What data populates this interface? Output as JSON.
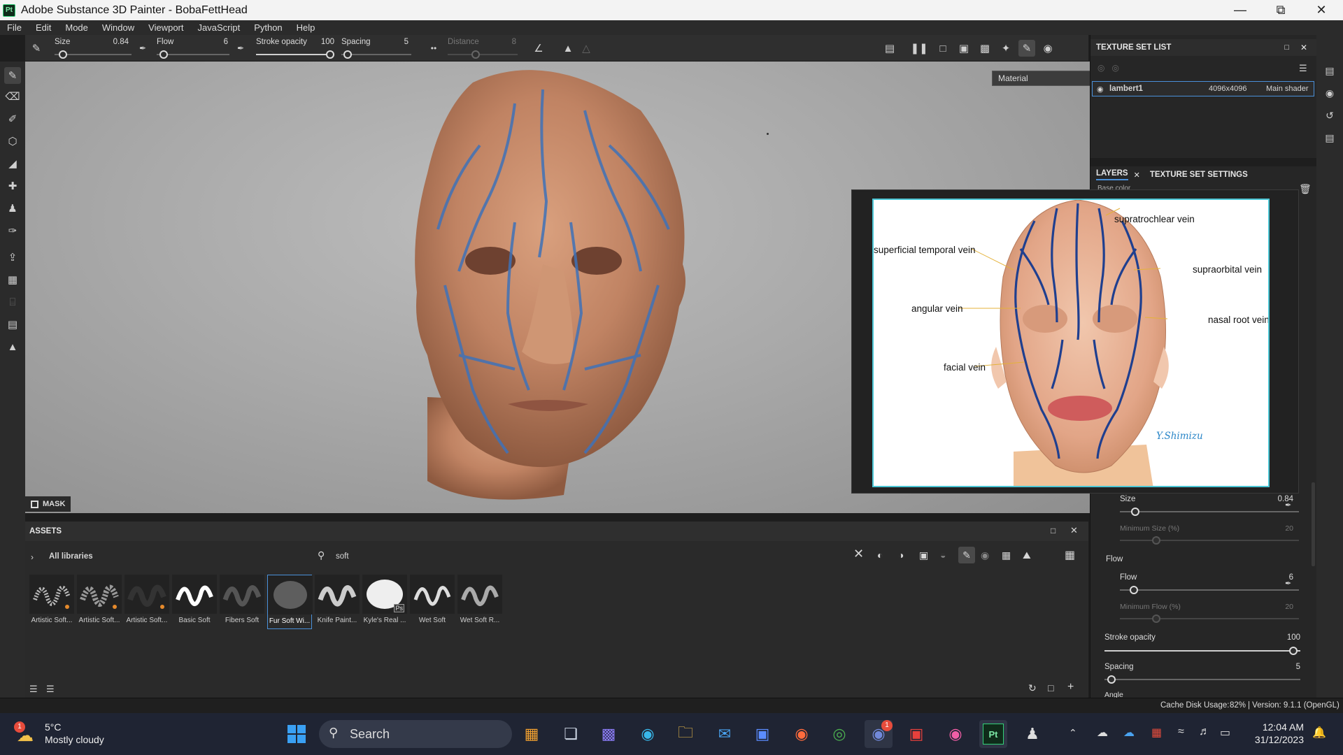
{
  "window": {
    "title": "Adobe Substance 3D Painter - BobaFettHead",
    "app_icon": "Pt"
  },
  "menu": [
    "File",
    "Edit",
    "Mode",
    "Window",
    "Viewport",
    "JavaScript",
    "Python",
    "Help"
  ],
  "tool_options": {
    "size_label": "Size",
    "size_value": "0.84",
    "flow_label": "Flow",
    "flow_value": "6",
    "stroke_opacity_label": "Stroke opacity",
    "stroke_opacity_value": "100",
    "spacing_label": "Spacing",
    "spacing_value": "5",
    "distance_label": "Distance",
    "distance_value": "8"
  },
  "viewport": {
    "material_mode": "Material",
    "mask_label": "MASK"
  },
  "texture_set_list": {
    "title": "TEXTURE SET LIST",
    "row": {
      "name": "lambert1",
      "resolution": "4096x4096",
      "shader": "Main shader"
    }
  },
  "layers": {
    "tab_layers": "LAYERS",
    "tab_texture_settings": "TEXTURE SET SETTINGS",
    "channel_select": "Base color"
  },
  "properties": {
    "size_label": "Size",
    "size_value": "0.84",
    "min_size_label": "Minimum Size (%)",
    "min_size_value": "20",
    "flow_section": "Flow",
    "flow_label": "Flow",
    "flow_value": "6",
    "min_flow_label": "Minimum Flow (%)",
    "min_flow_value": "20",
    "stroke_opacity_label": "Stroke opacity",
    "stroke_opacity_value": "100",
    "spacing_label": "Spacing",
    "spacing_value": "5",
    "angle_label": "Angle"
  },
  "assets": {
    "title": "ASSETS",
    "library": "All libraries",
    "search_value": "soft",
    "items": [
      {
        "label": "Artistic Soft..."
      },
      {
        "label": "Artistic Soft..."
      },
      {
        "label": "Artistic Soft..."
      },
      {
        "label": "Basic Soft"
      },
      {
        "label": "Fibers Soft"
      },
      {
        "label": "Fur Soft Wi..."
      },
      {
        "label": "Knife Paint..."
      },
      {
        "label": "Kyle's Real ..."
      },
      {
        "label": "Wet Soft"
      },
      {
        "label": "Wet Soft R..."
      }
    ],
    "badge_ps": "Ps"
  },
  "reference_image": {
    "labels": {
      "supratrochlear": "supratrochlear vein",
      "superficial_temporal": "superficial temporal vein",
      "supraorbital": "supraorbital vein",
      "angular": "angular vein",
      "nasal_root": "nasal root vein",
      "facial": "facial vein",
      "signature": "Y.Shimizu"
    }
  },
  "status": {
    "cache": "Cache Disk Usage:",
    "cache_value": "82%",
    "version": "| Version: 9.1.1 (OpenGL)"
  },
  "taskbar": {
    "weather_temp": "5°C",
    "weather_desc": "Mostly cloudy",
    "weather_badge": "1",
    "search_placeholder": "Search",
    "discord_badge": "1",
    "time": "12:04 AM",
    "date": "31/12/2023"
  },
  "colors": {
    "accent": "#4cc7d6",
    "vein": "#1f3f8f",
    "skin": "#c98a66"
  }
}
